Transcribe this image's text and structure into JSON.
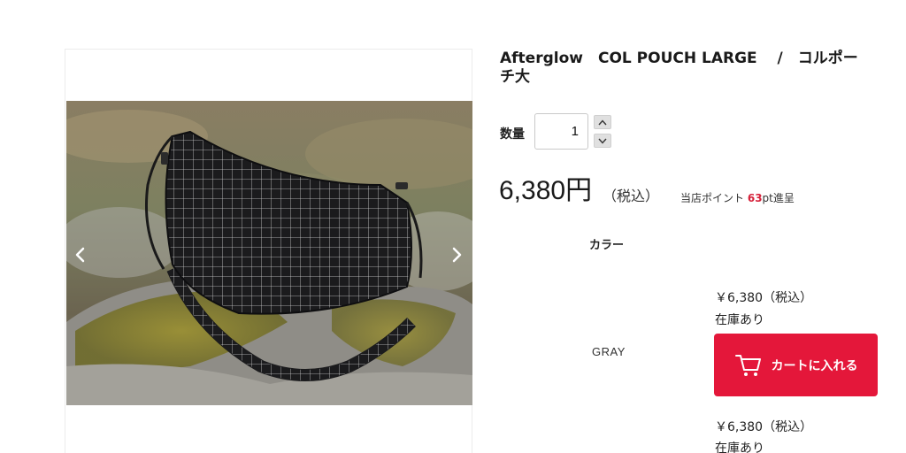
{
  "product": {
    "title": "Afterglow　COL POUCH LARGE　 /　コルポーチ大",
    "photo_alt": "Black grid-pattern pouch bag on a mossy rock",
    "gallery": {
      "prev_icon": "chevron-left-icon",
      "next_icon": "chevron-right-icon"
    }
  },
  "quantity": {
    "label": "数量",
    "value": "1"
  },
  "price": {
    "amount": "6,380円",
    "tax_note": "（税込）",
    "points_prefix": "当店ポイント",
    "points_value": "63",
    "points_suffix": "pt進呈"
  },
  "variants": {
    "header": "カラー",
    "rows": [
      {
        "name": "GRAY",
        "price": "￥6,380（税込）",
        "stock": "在庫あり",
        "cart_label": "カートに入れる"
      },
      {
        "name": "",
        "price": "￥6,380（税込）",
        "stock": "在庫あり"
      }
    ]
  },
  "colors": {
    "accent": "#e4173a",
    "points": "#d6213a"
  }
}
